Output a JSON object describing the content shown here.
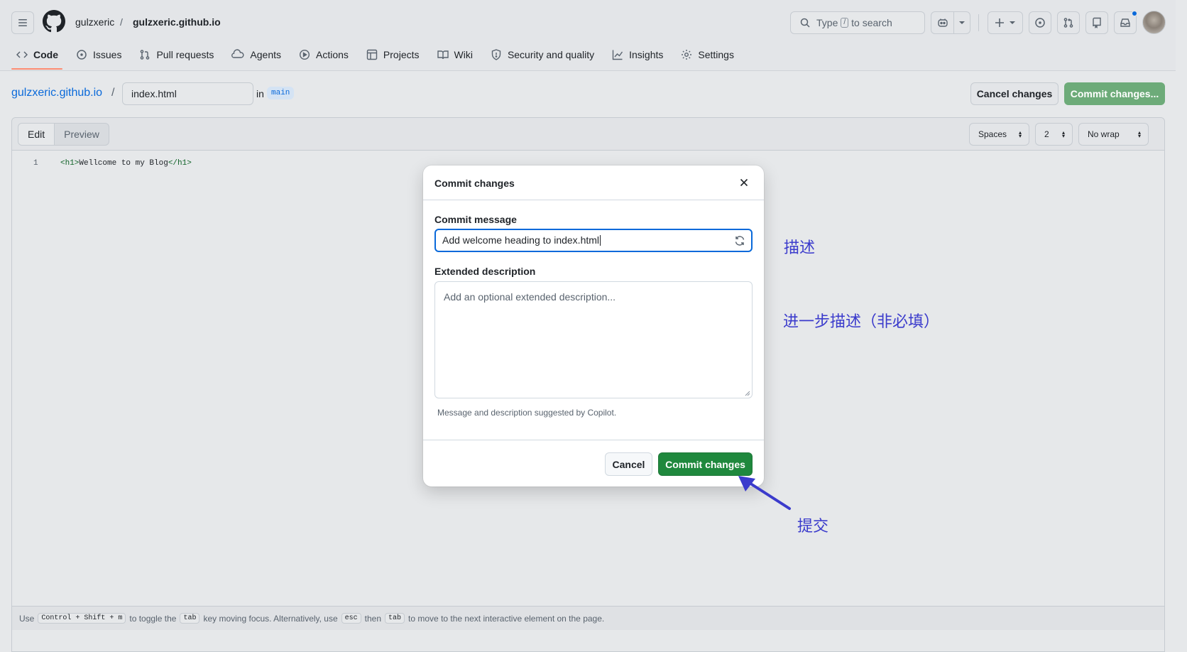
{
  "header": {
    "owner": "gulzxeric",
    "separator": "/",
    "repo": "gulzxeric.github.io",
    "search_prefix": "Type",
    "search_key": "/",
    "search_suffix": "to search"
  },
  "tabs": [
    {
      "label": "Code",
      "icon": "code-icon",
      "active": true
    },
    {
      "label": "Issues",
      "icon": "issue-icon"
    },
    {
      "label": "Pull requests",
      "icon": "pull-request-icon"
    },
    {
      "label": "Agents",
      "icon": "agents-icon"
    },
    {
      "label": "Actions",
      "icon": "play-icon"
    },
    {
      "label": "Projects",
      "icon": "table-icon"
    },
    {
      "label": "Wiki",
      "icon": "book-icon"
    },
    {
      "label": "Security and quality",
      "icon": "shield-icon"
    },
    {
      "label": "Insights",
      "icon": "graph-icon"
    },
    {
      "label": "Settings",
      "icon": "gear-icon"
    }
  ],
  "breadcrumb": {
    "repo": "gulzxeric.github.io",
    "separator": "/",
    "filename": "index.html",
    "in": "in",
    "branch": "main"
  },
  "actions": {
    "cancel": "Cancel changes",
    "commit": "Commit changes..."
  },
  "editor": {
    "tab_edit": "Edit",
    "tab_preview": "Preview",
    "indent_mode": "Spaces",
    "indent_size": "2",
    "wrap_mode": "No wrap",
    "line_number": "1",
    "code_open_tag": "<h1>",
    "code_text": "Wellcome to my Blog",
    "code_close_tag": "</h1>"
  },
  "footer": {
    "p1": "Use",
    "k1": "Control + Shift + m",
    "p2": "to toggle the",
    "k2": "tab",
    "p3": "key moving focus. Alternatively, use",
    "k3": "esc",
    "p4": "then",
    "k4": "tab",
    "p5": "to move to the next interactive element on the page."
  },
  "modal": {
    "title": "Commit changes",
    "message_label": "Commit message",
    "message_value": "Add welcome heading to index.html",
    "description_label": "Extended description",
    "description_placeholder": "Add an optional extended description...",
    "hint": "Message and description suggested by Copilot.",
    "cancel": "Cancel",
    "commit": "Commit changes"
  },
  "annotations": {
    "describe": "描述",
    "extended": "进一步描述（非必填）",
    "submit": "提交",
    "color": "#3b3bcc"
  },
  "colors": {
    "accent": "#0969da",
    "commit_green": "#1f883d",
    "tab_underline": "#fd8c73"
  }
}
